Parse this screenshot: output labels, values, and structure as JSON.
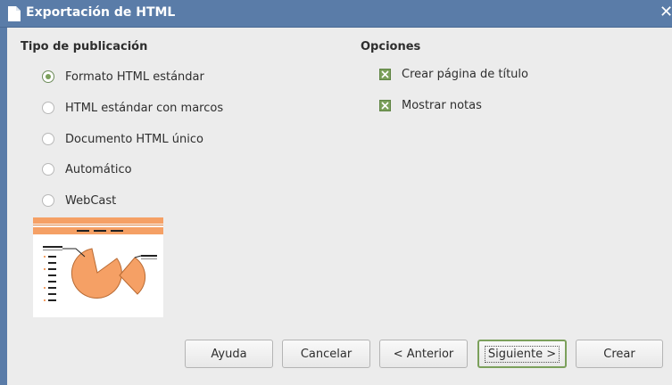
{
  "window": {
    "title": "Exportación de HTML",
    "close_glyph": "✕"
  },
  "publication": {
    "heading": "Tipo de publicación",
    "options": [
      {
        "label": "Formato HTML estándar",
        "selected": true
      },
      {
        "label": "HTML estándar con marcos",
        "selected": false
      },
      {
        "label": "Documento HTML único",
        "selected": false
      },
      {
        "label": "Automático",
        "selected": false
      },
      {
        "label": "WebCast",
        "selected": false
      }
    ]
  },
  "options": {
    "heading": "Opciones",
    "items": [
      {
        "label": "Crear página de título",
        "checked": true
      },
      {
        "label": "Mostrar notas",
        "checked": true
      }
    ]
  },
  "buttons": {
    "help": "Ayuda",
    "cancel": "Cancelar",
    "back": "< Anterior",
    "next": "Siguiente >",
    "create": "Crear"
  },
  "colors": {
    "titlebar": "#5a7ca8",
    "accent_green": "#7ba05b",
    "preview_orange": "#f5a065"
  },
  "icons": [
    "document-icon",
    "close-icon",
    "radio-selected",
    "checkbox-checked",
    "layout-preview"
  ]
}
